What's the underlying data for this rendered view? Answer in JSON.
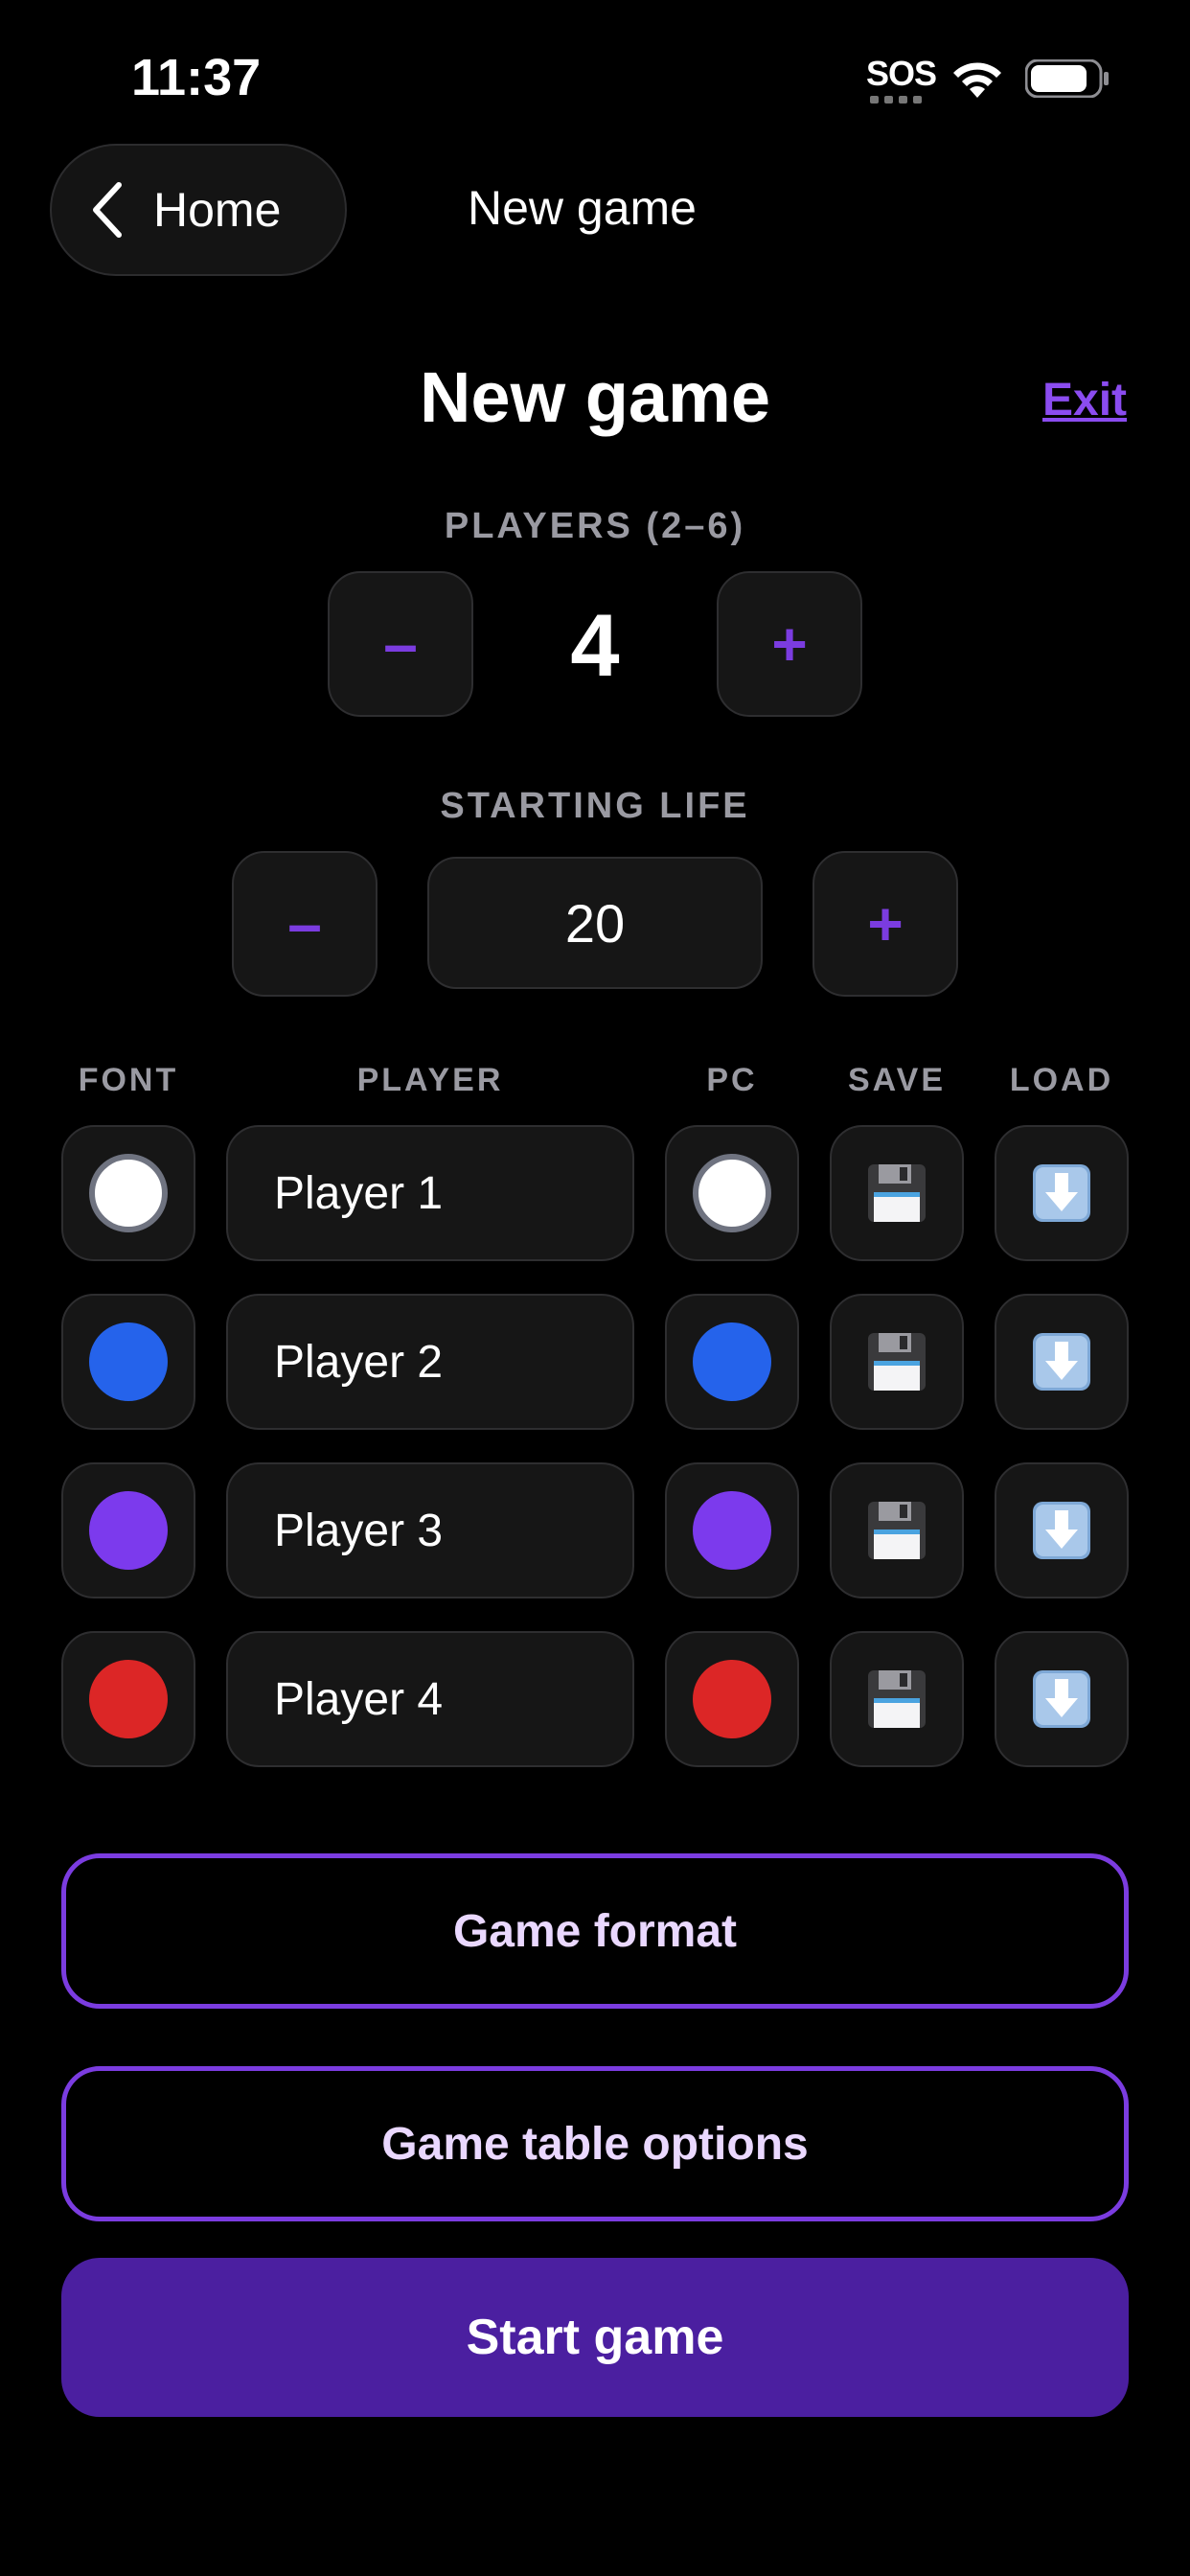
{
  "status": {
    "time": "11:37",
    "sos": "SOS"
  },
  "nav": {
    "back_label": "Home",
    "title": "New game"
  },
  "header": {
    "title": "New game",
    "exit_label": "Exit"
  },
  "players": {
    "label": "PLAYERS (2–6)",
    "value": "4",
    "minus": "–",
    "plus": "+"
  },
  "life": {
    "label": "STARTING LIFE",
    "value": "20",
    "minus": "–",
    "plus": "+"
  },
  "columns": {
    "font": "FONT",
    "player": "PLAYER",
    "pc": "PC",
    "save": "SAVE",
    "load": "LOAD"
  },
  "rows": [
    {
      "name": "Player 1",
      "color": "#ffffff"
    },
    {
      "name": "Player 2",
      "color": "#2563eb"
    },
    {
      "name": "Player 3",
      "color": "#7c3aed"
    },
    {
      "name": "Player 4",
      "color": "#dc2626"
    }
  ],
  "buttons": {
    "game_format": "Game format",
    "table_options": "Game table options",
    "start": "Start game"
  },
  "icons": {
    "save": "floppy-disk-icon",
    "load": "download-arrow-icon"
  },
  "colors": {
    "accent": "#7b3ce0",
    "start_bg": "#4b1fa0"
  }
}
